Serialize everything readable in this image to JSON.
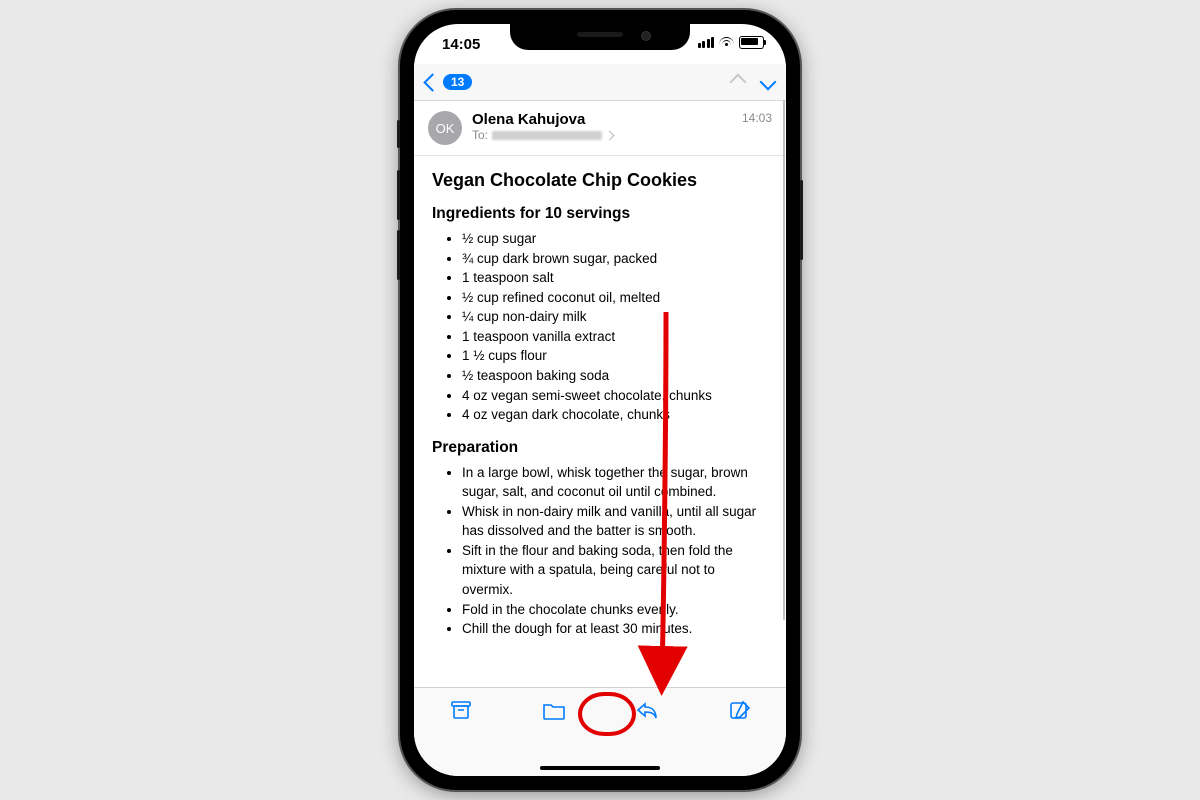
{
  "status": {
    "time": "14:05"
  },
  "nav": {
    "unread_count": "13"
  },
  "email": {
    "avatar_initials": "OK",
    "sender": "Olena Kahujova",
    "to_label": "To:",
    "time": "14:03"
  },
  "content": {
    "title": "Vegan Chocolate Chip Cookies",
    "ingredients_heading": "Ingredients for 10 servings",
    "ingredients": [
      "½ cup sugar",
      "¾ cup dark brown sugar, packed",
      "1 teaspoon salt",
      "½ cup refined coconut oil, melted",
      "¼ cup non-dairy milk",
      "1 teaspoon vanilla extract",
      "1 ½ cups flour",
      "½ teaspoon baking soda",
      "4 oz vegan semi-sweet chocolate, chunks",
      "4 oz vegan dark chocolate, chunks"
    ],
    "preparation_heading": "Preparation",
    "preparation": [
      "In a large bowl, whisk together the sugar, brown sugar, salt, and coconut oil until combined.",
      "Whisk in non-dairy milk and vanilla, until all sugar has dissolved and the batter is smooth.",
      "Sift in the flour and baking soda, then fold the mixture with a spatula, being careful not to overmix.",
      "Fold in the chocolate chunks evenly.",
      "Chill the dough for at least 30 minutes."
    ]
  },
  "annotation": {
    "target": "reply-button"
  }
}
